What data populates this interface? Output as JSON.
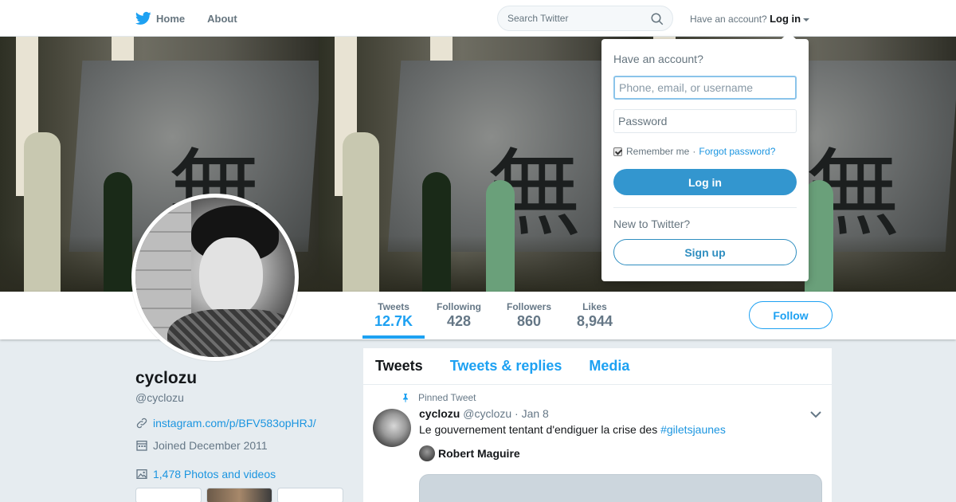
{
  "nav": {
    "home_label": "Home",
    "about_label": "About",
    "search_placeholder": "Search Twitter",
    "have_account": "Have an account?",
    "login_label": "Log in"
  },
  "colors": {
    "brand": "#1da1f2",
    "link": "#1b95e0",
    "button": "#3396cf"
  },
  "banner": {
    "kanji": "無"
  },
  "stats": [
    {
      "label": "Tweets",
      "value": "12.7K"
    },
    {
      "label": "Following",
      "value": "428"
    },
    {
      "label": "Followers",
      "value": "860"
    },
    {
      "label": "Likes",
      "value": "8,944"
    }
  ],
  "follow_label": "Follow",
  "profile": {
    "name": "cyclozu",
    "handle": "@cyclozu",
    "link": "instagram.com/p/BFV583opHRJ/",
    "joined": "Joined December 2011",
    "photos": "1,478 Photos and videos"
  },
  "timeline": {
    "tabs": [
      "Tweets",
      "Tweets & replies",
      "Media"
    ],
    "pinned_label": "Pinned Tweet",
    "tweet": {
      "name": "cyclozu",
      "handle": "@cyclozu",
      "date": "· Jan 8",
      "text": "Le gouvernement tentant d'endiguer la crise des ",
      "hashtag": "#giletsjaunes",
      "quoted_name": "Robert Maguire"
    }
  },
  "login_dropdown": {
    "title": "Have an account?",
    "username_placeholder": "Phone, email, or username",
    "password_placeholder": "Password",
    "remember": "Remember me",
    "separator": "·",
    "forgot": "Forgot password?",
    "login_button": "Log in",
    "new_label": "New to Twitter?",
    "signup_button": "Sign up"
  }
}
